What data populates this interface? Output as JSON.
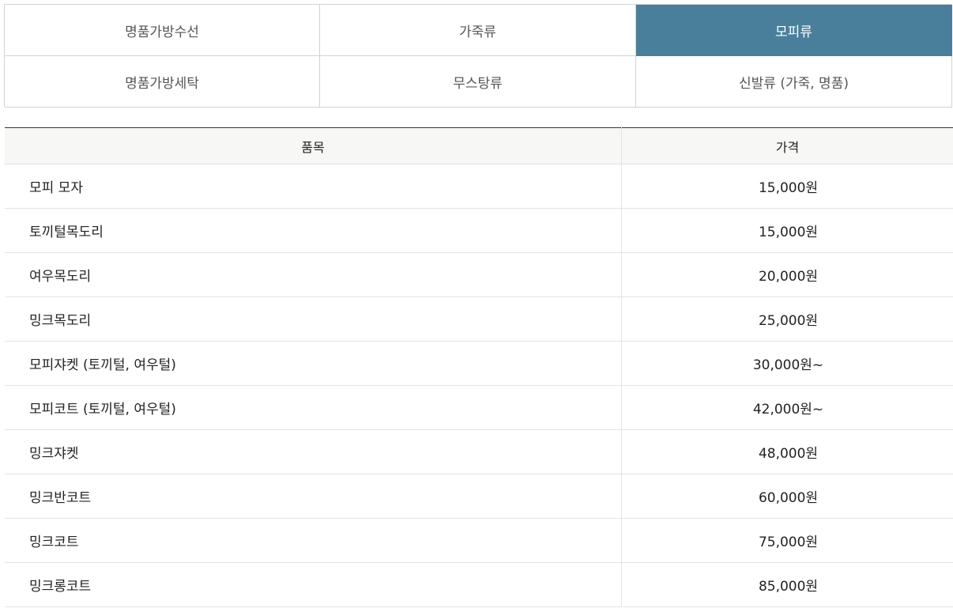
{
  "tabs": [
    {
      "label": "명품가방수선",
      "active": false
    },
    {
      "label": "가죽류",
      "active": false
    },
    {
      "label": "모피류",
      "active": true
    },
    {
      "label": "명품가방세탁",
      "active": false
    },
    {
      "label": "무스탕류",
      "active": false
    },
    {
      "label": "신발류 (가죽, 명품)",
      "active": false
    }
  ],
  "table": {
    "headers": {
      "item": "품목",
      "price": "가격"
    },
    "rows": [
      {
        "item": "모피 모자",
        "price": "15,000원"
      },
      {
        "item": "토끼털목도리",
        "price": "15,000원"
      },
      {
        "item": "여우목도리",
        "price": "20,000원"
      },
      {
        "item": "밍크목도리",
        "price": "25,000원"
      },
      {
        "item": "모피쟈켓 (토끼털, 여우털)",
        "price": "30,000원~"
      },
      {
        "item": "모피코트 (토끼털, 여우털)",
        "price": "42,000원~"
      },
      {
        "item": "밍크쟈켓",
        "price": "48,000원"
      },
      {
        "item": "밍크반코트",
        "price": "60,000원"
      },
      {
        "item": "밍크코트",
        "price": "75,000원"
      },
      {
        "item": "밍크롱코트",
        "price": "85,000원"
      }
    ]
  },
  "colors": {
    "active_tab": "#4a7f9c"
  }
}
